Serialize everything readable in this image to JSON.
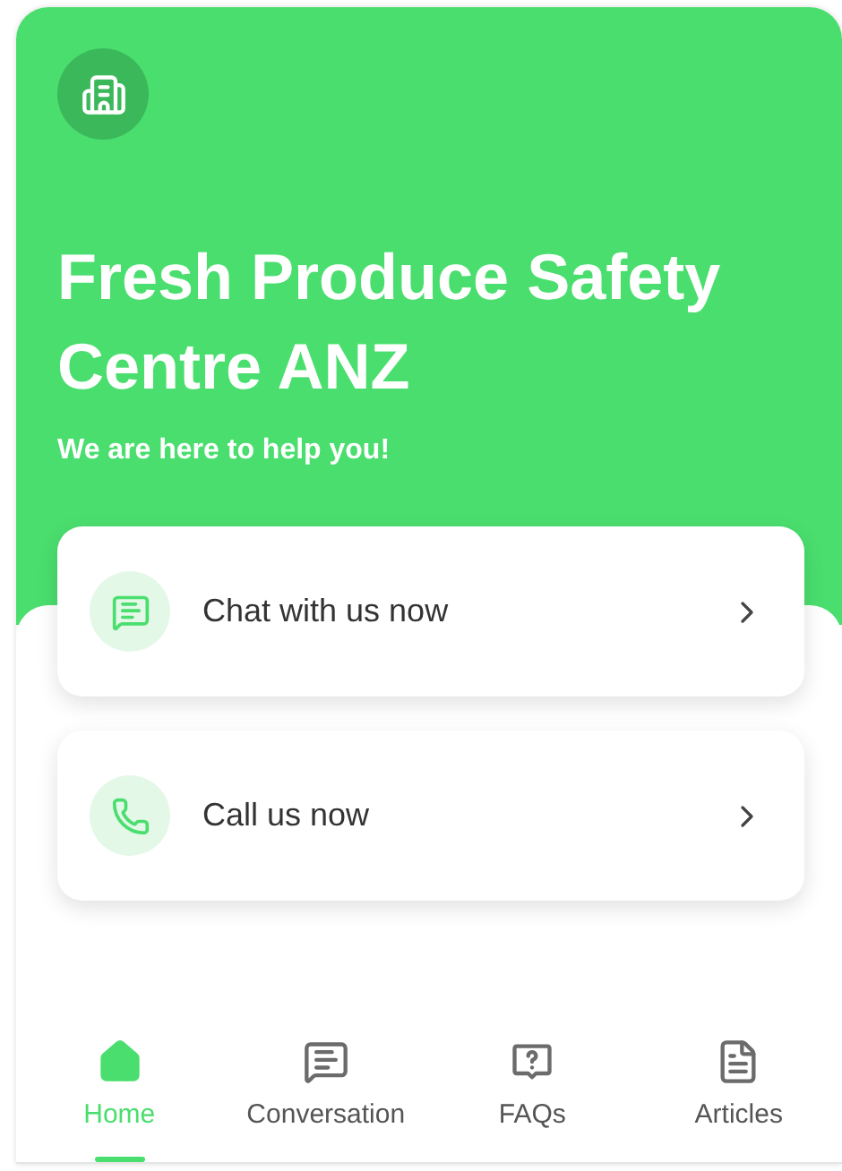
{
  "header": {
    "title": "Fresh Produce Safety Centre ANZ",
    "subtitle": "We are here to help you!"
  },
  "actions": [
    {
      "kind": "chat",
      "label": "Chat with us now"
    },
    {
      "kind": "call",
      "label": "Call us now"
    }
  ],
  "nav": [
    {
      "kind": "home",
      "label": "Home",
      "selected": true
    },
    {
      "kind": "conversation",
      "label": "Conversation",
      "selected": false
    },
    {
      "kind": "faqs",
      "label": "FAQs",
      "selected": false
    },
    {
      "kind": "articles",
      "label": "Articles",
      "selected": false
    }
  ]
}
